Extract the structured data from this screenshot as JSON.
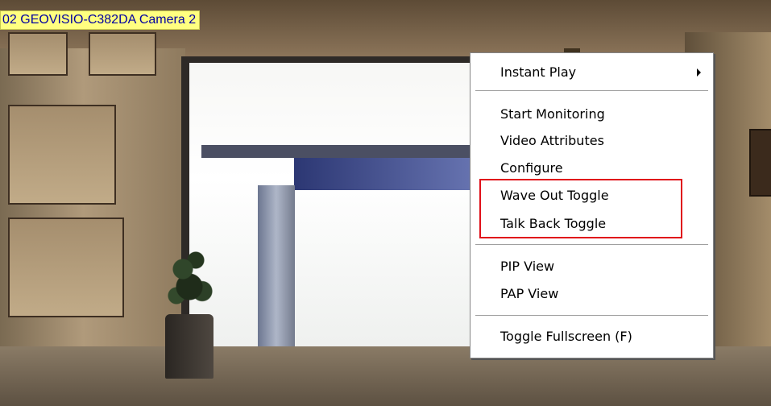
{
  "camera": {
    "title": "02 GEOVISIO-C382DA Camera 2"
  },
  "context_menu": {
    "instant_play": "Instant Play",
    "start_monitoring": "Start Monitoring",
    "video_attributes": "Video Attributes",
    "configure": "Configure",
    "wave_out_toggle": "Wave Out Toggle",
    "talk_back_toggle": "Talk Back Toggle",
    "pip_view": "PIP View",
    "pap_view": "PAP View",
    "toggle_fullscreen": "Toggle Fullscreen   (F)"
  },
  "icons": {
    "submenu_arrow": "chevron-right-icon"
  },
  "colors": {
    "label_background": "#ffff80",
    "label_text": "#0000a0",
    "highlight": "#e0101a",
    "menu_background": "#ffffff"
  }
}
